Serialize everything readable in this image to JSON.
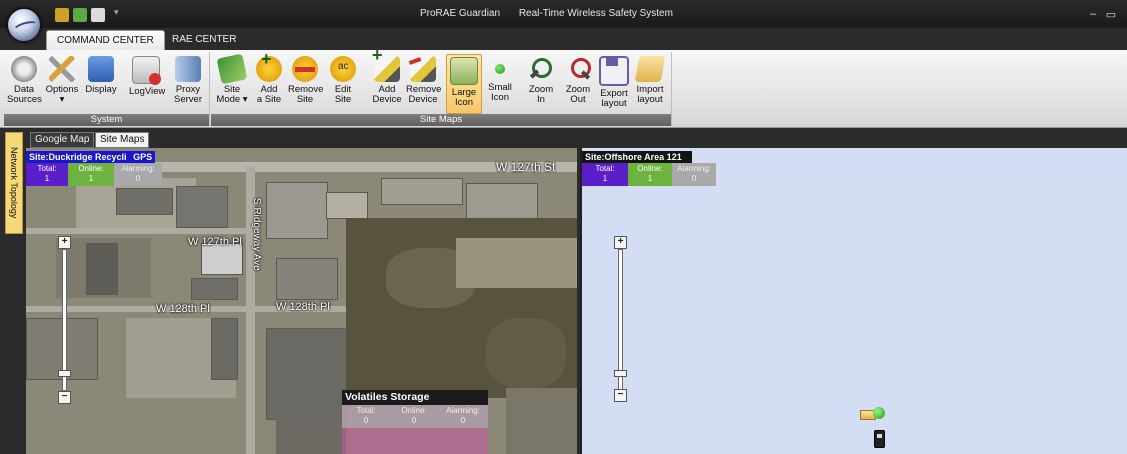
{
  "app": {
    "name": "ProRAE Guardian",
    "subtitle": "Real-Time Wireless Safety System",
    "minimize": "–",
    "maximize": "▭"
  },
  "tabs": [
    {
      "label": "COMMAND CENTER",
      "active": true
    },
    {
      "label": "RAE CENTER",
      "active": false
    }
  ],
  "ribbon": {
    "system": {
      "label": "System",
      "buttons": [
        {
          "label": "Data\nSources",
          "icon": "gears-icon"
        },
        {
          "label": "Options\n▾",
          "icon": "wrench-icon"
        },
        {
          "label": "Display",
          "icon": "display-icon"
        },
        {
          "label": "LogView",
          "icon": "logview-icon"
        },
        {
          "label": "Proxy\nServer",
          "icon": "proxy-server-icon"
        }
      ]
    },
    "site_maps": {
      "label": "Site Maps",
      "buttons": [
        {
          "label": "Site\nMode ▾",
          "icon": "site-mode-icon"
        },
        {
          "label": "Add\na Site",
          "icon": "add-site-icon"
        },
        {
          "label": "Remove\nSite",
          "icon": "remove-site-icon"
        },
        {
          "label": "Edit\nSite",
          "icon": "edit-site-icon"
        },
        {
          "label": "Add\nDevice",
          "icon": "add-device-icon"
        },
        {
          "label": "Remove\nDevice",
          "icon": "remove-device-icon"
        },
        {
          "label": "Large\nIcon",
          "icon": "large-icon-icon",
          "selected": true
        },
        {
          "label": "Small\nIcon",
          "icon": "small-icon-icon"
        },
        {
          "label": "Zoom\nIn",
          "icon": "zoom-in-icon"
        },
        {
          "label": "Zoom\nOut",
          "icon": "zoom-out-icon"
        },
        {
          "label": "Export\nlayout",
          "icon": "export-layout-icon"
        },
        {
          "label": "Import\nlayout",
          "icon": "import-layout-icon"
        }
      ]
    }
  },
  "side_tab": "Network Topology",
  "view_tabs": [
    {
      "label": "Google Map",
      "active": false
    },
    {
      "label": "Site Maps",
      "active": true
    }
  ],
  "stat_labels": {
    "total": "Total:",
    "online": "Online:",
    "alarming": "Alarming:"
  },
  "left_site": {
    "name": "Site:Duckridge Recycli",
    "gps": "GPS",
    "total": "1",
    "online": "1",
    "alarming": "0"
  },
  "map_labels": {
    "w127th_st": "W 127th St",
    "w127th_pl": "W 127th Pl",
    "w128th_pl_a": "W 128th Pl",
    "w128th_pl_b": "W 128th Pl",
    "ridgeway": "S Ridgeway Ave"
  },
  "volatiles": {
    "name": "Volatiles Storage",
    "total": "0",
    "online": "0",
    "alarming": "0"
  },
  "right_site": {
    "name": "Site:Offshore Area 121",
    "total": "1",
    "online": "1",
    "alarming": "0"
  },
  "zoom": {
    "plus": "+",
    "minus": "−"
  },
  "colors": {
    "total": "#5a1fc8",
    "online": "#6db33f",
    "alarming": "#a9a9a9",
    "site_header": "#1a16c9",
    "selected_ribbon": "#f8c86a"
  }
}
